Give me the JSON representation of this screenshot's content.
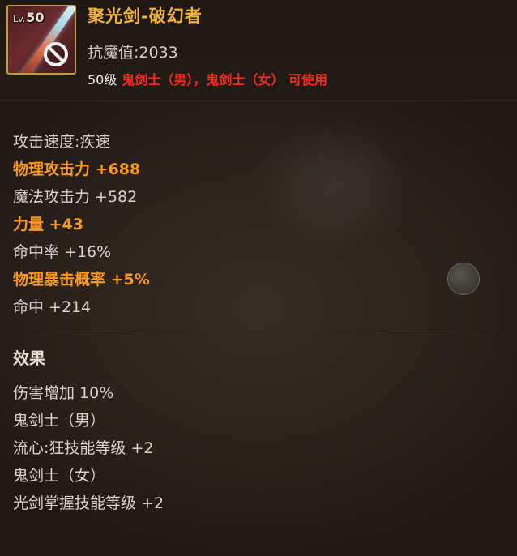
{
  "item": {
    "level_prefix": "Lv.",
    "level": "50",
    "name": "聚光剑-破幻者",
    "resistance": "抗魔值:2033",
    "requirement_level": "50级",
    "requirement_classes": "鬼剑士（男），鬼剑士（女） 可使用",
    "icon": "sword-icon",
    "restriction_icon": "prohibited-icon"
  },
  "stats": [
    {
      "text": "攻击速度:疾速",
      "highlight": false
    },
    {
      "text": "物理攻击力 +688",
      "highlight": true
    },
    {
      "text": "魔法攻击力 +582",
      "highlight": false
    },
    {
      "text": "力量 +43",
      "highlight": true
    },
    {
      "text": "命中率 +16%",
      "highlight": false
    },
    {
      "text": "物理暴击概率 +5%",
      "highlight": true
    },
    {
      "text": "命中 +214",
      "highlight": false
    }
  ],
  "effects": {
    "title": "效果",
    "lines": [
      "伤害增加 10%",
      "鬼剑士（男）",
      "流心:狂技能等级 +2",
      "鬼剑士（女）",
      "光剑掌握技能等级 +2"
    ]
  },
  "colors": {
    "name": "#f2b43a",
    "highlight": "#ff9a1f",
    "class_req": "#ff2a1f",
    "text": "#d8d3cb"
  }
}
